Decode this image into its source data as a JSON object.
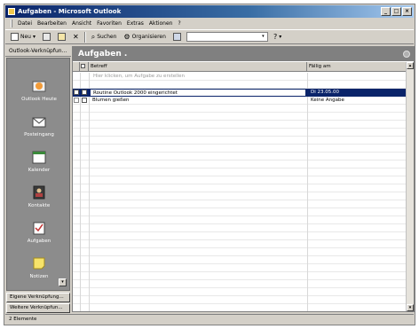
{
  "window": {
    "title": "Aufgaben - Microsoft Outlook",
    "minimize": "_",
    "maximize": "□",
    "close": "×"
  },
  "menu": [
    "Datei",
    "Bearbeiten",
    "Ansicht",
    "Favoriten",
    "Extras",
    "Aktionen",
    "?"
  ],
  "toolbar": {
    "new_label": "Neu",
    "search_label": "Suchen",
    "organize_label": "Organisieren",
    "combo_value": ""
  },
  "nav": {
    "header": "Outlook-Verknüpfun...",
    "items": [
      {
        "label": "Outlook Heute",
        "icon": "outlook-today-icon"
      },
      {
        "label": "Posteingang",
        "icon": "inbox-icon"
      },
      {
        "label": "Kalender",
        "icon": "calendar-icon"
      },
      {
        "label": "Kontakte",
        "icon": "contacts-icon"
      },
      {
        "label": "Aufgaben",
        "icon": "tasks-icon"
      },
      {
        "label": "Notizen",
        "icon": "notes-icon"
      }
    ],
    "group_own": "Eigene Verknüpfung...",
    "group_other": "Weitere Verknüpfun..."
  },
  "main": {
    "title": "Aufgaben .",
    "columns": {
      "subject": "Betreff",
      "due": "Fällig am"
    },
    "new_task_placeholder": "Hier klicken, um Aufgabe zu erstellen",
    "tasks": [
      {
        "subject": "Routine Outlook 2000 eingerichtet",
        "due": "Di 23.05.00",
        "selected": true
      },
      {
        "subject": "Blumen gießen",
        "due": "Keine Angabe",
        "selected": false
      }
    ]
  },
  "status": {
    "text": "2 Elemente"
  },
  "colors": {
    "title_bar": "#0a246a",
    "chrome": "#d4d0c8",
    "nav_bg": "#8c8c8c",
    "selection": "#0a246a"
  }
}
